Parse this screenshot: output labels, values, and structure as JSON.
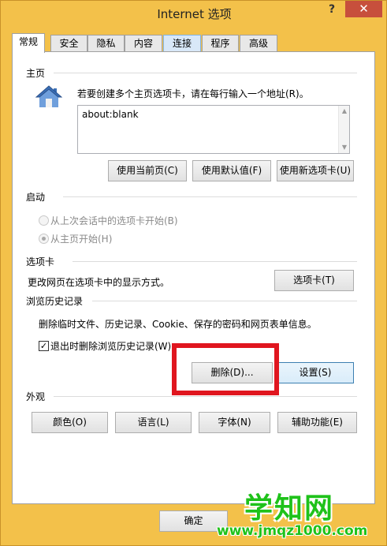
{
  "window": {
    "title": "Internet 选项",
    "help_glyph": "?",
    "close_glyph": "✕"
  },
  "tabs": [
    {
      "label": "常规",
      "active": true
    },
    {
      "label": "安全"
    },
    {
      "label": "隐私"
    },
    {
      "label": "内容"
    },
    {
      "label": "连接",
      "hover": true
    },
    {
      "label": "程序"
    },
    {
      "label": "高级"
    }
  ],
  "homepage": {
    "section_title": "主页",
    "instruction": "若要创建多个主页选项卡，请在每行输入一个地址(R)。",
    "value": "about:blank",
    "buttons": {
      "use_current": "使用当前页(C)",
      "use_default": "使用默认值(F)",
      "use_new_tab": "使用新选项卡(U)"
    }
  },
  "startup": {
    "section_title": "启动",
    "option_last_session": "从上次会话中的选项卡开始(B)",
    "option_home_page": "从主页开始(H)",
    "selected": "option_home_page"
  },
  "tabs_section": {
    "section_title": "选项卡",
    "description": "更改网页在选项卡中的显示方式。",
    "button": "选项卡(T)"
  },
  "history": {
    "section_title": "浏览历史记录",
    "description": "删除临时文件、历史记录、Cookie、保存的密码和网页表单信息。",
    "checkbox_label": "退出时删除浏览历史记录(W)",
    "checkbox_checked": true,
    "delete_button": "删除(D)...",
    "settings_button": "设置(S)"
  },
  "appearance": {
    "section_title": "外观",
    "buttons": {
      "colors": "颜色(O)",
      "languages": "语言(L)",
      "fonts": "字体(N)",
      "accessibility": "辅助功能(E)"
    }
  },
  "footer": {
    "ok_button": "确定"
  },
  "watermark": {
    "text": "学知网",
    "url": "www.jmqz1000.com"
  },
  "colors": {
    "window_frame": "#f3c14a",
    "highlight_box": "#e0161f",
    "watermark": "#1fc21a"
  }
}
